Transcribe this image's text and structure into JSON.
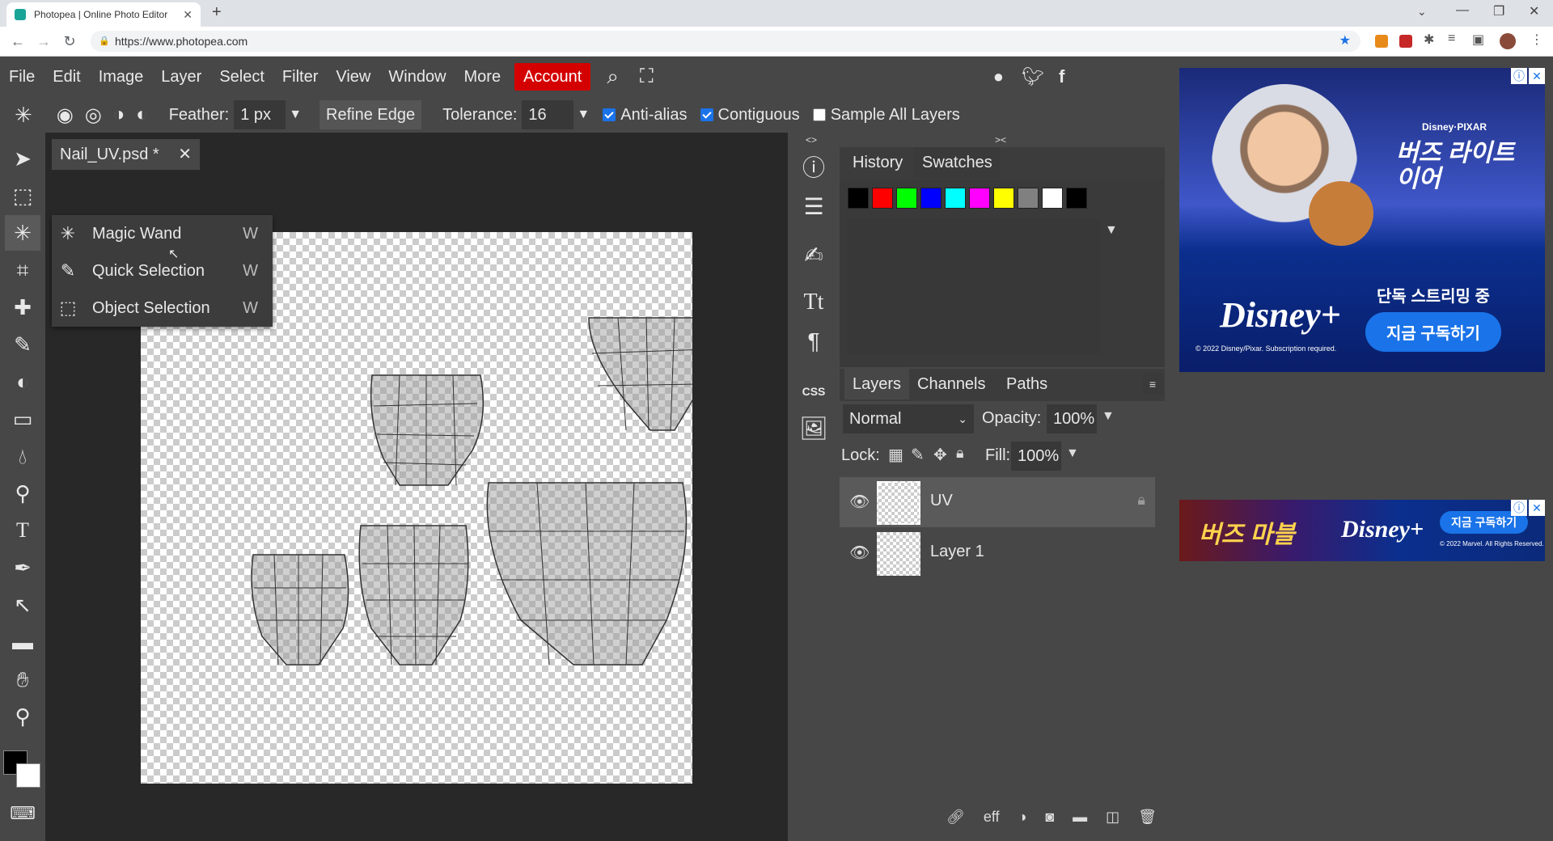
{
  "browser": {
    "tab_title": "Photopea | Online Photo Editor",
    "url": "https://www.photopea.com"
  },
  "menu": {
    "items": [
      "File",
      "Edit",
      "Image",
      "Layer",
      "Select",
      "Filter",
      "View",
      "Window",
      "More"
    ],
    "account": "Account"
  },
  "options": {
    "feather_label": "Feather:",
    "feather_value": "1 px",
    "refine_edge": "Refine Edge",
    "tolerance_label": "Tolerance:",
    "tolerance_value": "16",
    "anti_alias": "Anti-alias",
    "anti_alias_checked": true,
    "contiguous": "Contiguous",
    "contiguous_checked": true,
    "sample_all_layers": "Sample All Layers",
    "sample_all_layers_checked": false
  },
  "document": {
    "tab_label": "Nail_UV.psd *"
  },
  "tool_flyout": [
    {
      "label": "Magic Wand",
      "shortcut": "W"
    },
    {
      "label": "Quick Selection",
      "shortcut": "W"
    },
    {
      "label": "Object Selection",
      "shortcut": "W"
    }
  ],
  "panels": {
    "top_tabs": [
      "History",
      "Swatches"
    ],
    "active_top_tab": "Swatches",
    "swatches": [
      "#000000",
      "#ff0000",
      "#00ff00",
      "#0000ff",
      "#00ffff",
      "#ff00ff",
      "#ffff00",
      "#808080",
      "#ffffff",
      "#000000"
    ],
    "bottom_tabs": [
      "Layers",
      "Channels",
      "Paths"
    ],
    "active_bottom_tab": "Layers",
    "blend_mode": "Normal",
    "opacity_label": "Opacity:",
    "opacity_value": "100%",
    "lock_label": "Lock:",
    "fill_label": "Fill:",
    "fill_value": "100%",
    "side_css": "CSS",
    "layers": [
      {
        "name": "UV",
        "locked": true,
        "selected": true
      },
      {
        "name": "Layer 1",
        "locked": false,
        "selected": false
      }
    ]
  },
  "ads": {
    "ad1_brand": "Disney+",
    "ad1_pixar": "Disney·PIXAR",
    "ad1_title": "버즈 라이트이어",
    "ad1_stream": "단독 스트리밍 중",
    "ad1_cta": "지금 구독하기",
    "ad1_legal": "© 2022 Disney/Pixar. Subscription required.",
    "ad2_title": "버즈 마블",
    "ad2_brand": "Disney+",
    "ad2_cta": "지금 구독하기",
    "ad2_legal": "© 2022 Marvel. All Rights Reserved."
  }
}
